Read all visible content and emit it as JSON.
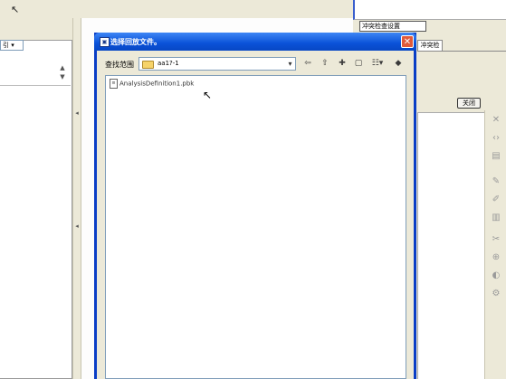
{
  "app": {
    "left_combo_value": "引 ▾",
    "right_input_value": "冲突检查设置",
    "right_tab_label": "冲突检查",
    "right_close_button": "关闭"
  },
  "dialog": {
    "title": "选择回放文件。",
    "look_in_label": "查找范围",
    "look_in_value": "aa1?-1",
    "files": [
      {
        "name": "AnalysisDefinition1.pbk"
      }
    ]
  },
  "icons": {
    "top_cursor": "pointer-icon",
    "close": "close-icon",
    "mouse": "mouse-pointer-icon"
  }
}
